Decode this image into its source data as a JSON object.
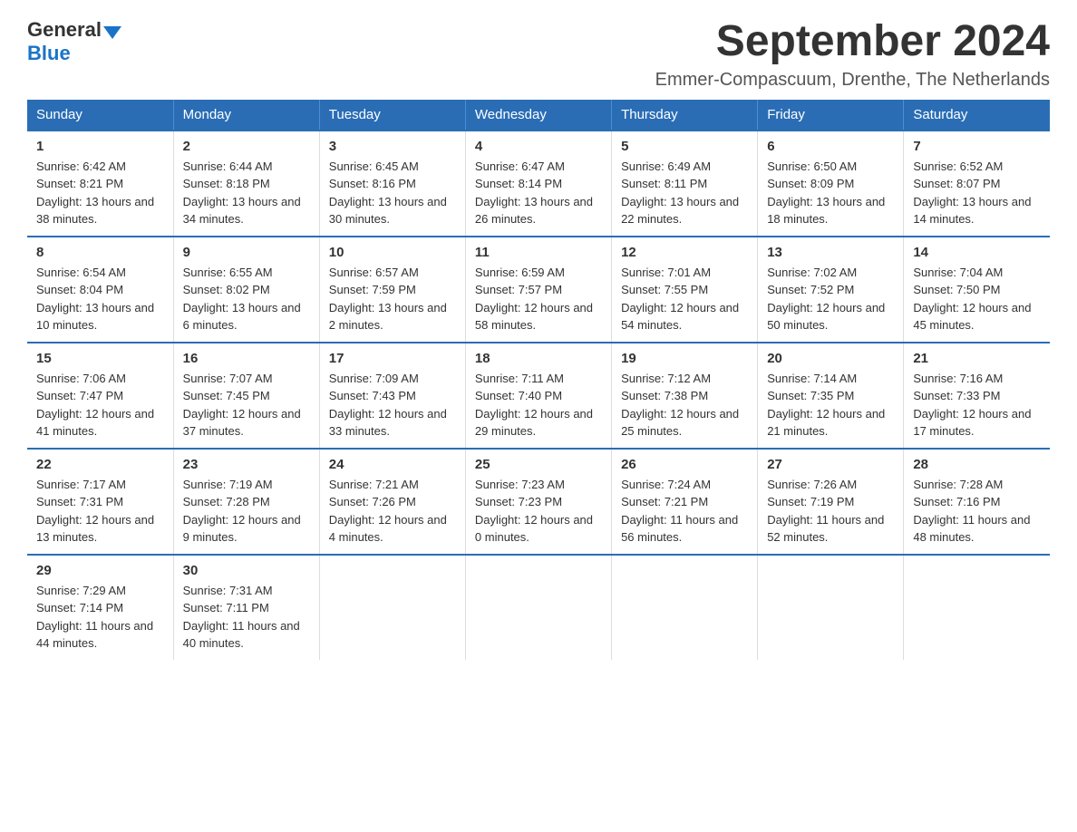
{
  "logo": {
    "general": "General",
    "blue": "Blue"
  },
  "title": {
    "month": "September 2024",
    "location": "Emmer-Compascuum, Drenthe, The Netherlands"
  },
  "header": {
    "days": [
      "Sunday",
      "Monday",
      "Tuesday",
      "Wednesday",
      "Thursday",
      "Friday",
      "Saturday"
    ]
  },
  "weeks": [
    [
      {
        "day": "1",
        "sunrise": "6:42 AM",
        "sunset": "8:21 PM",
        "daylight": "13 hours and 38 minutes."
      },
      {
        "day": "2",
        "sunrise": "6:44 AM",
        "sunset": "8:18 PM",
        "daylight": "13 hours and 34 minutes."
      },
      {
        "day": "3",
        "sunrise": "6:45 AM",
        "sunset": "8:16 PM",
        "daylight": "13 hours and 30 minutes."
      },
      {
        "day": "4",
        "sunrise": "6:47 AM",
        "sunset": "8:14 PM",
        "daylight": "13 hours and 26 minutes."
      },
      {
        "day": "5",
        "sunrise": "6:49 AM",
        "sunset": "8:11 PM",
        "daylight": "13 hours and 22 minutes."
      },
      {
        "day": "6",
        "sunrise": "6:50 AM",
        "sunset": "8:09 PM",
        "daylight": "13 hours and 18 minutes."
      },
      {
        "day": "7",
        "sunrise": "6:52 AM",
        "sunset": "8:07 PM",
        "daylight": "13 hours and 14 minutes."
      }
    ],
    [
      {
        "day": "8",
        "sunrise": "6:54 AM",
        "sunset": "8:04 PM",
        "daylight": "13 hours and 10 minutes."
      },
      {
        "day": "9",
        "sunrise": "6:55 AM",
        "sunset": "8:02 PM",
        "daylight": "13 hours and 6 minutes."
      },
      {
        "day": "10",
        "sunrise": "6:57 AM",
        "sunset": "7:59 PM",
        "daylight": "13 hours and 2 minutes."
      },
      {
        "day": "11",
        "sunrise": "6:59 AM",
        "sunset": "7:57 PM",
        "daylight": "12 hours and 58 minutes."
      },
      {
        "day": "12",
        "sunrise": "7:01 AM",
        "sunset": "7:55 PM",
        "daylight": "12 hours and 54 minutes."
      },
      {
        "day": "13",
        "sunrise": "7:02 AM",
        "sunset": "7:52 PM",
        "daylight": "12 hours and 50 minutes."
      },
      {
        "day": "14",
        "sunrise": "7:04 AM",
        "sunset": "7:50 PM",
        "daylight": "12 hours and 45 minutes."
      }
    ],
    [
      {
        "day": "15",
        "sunrise": "7:06 AM",
        "sunset": "7:47 PM",
        "daylight": "12 hours and 41 minutes."
      },
      {
        "day": "16",
        "sunrise": "7:07 AM",
        "sunset": "7:45 PM",
        "daylight": "12 hours and 37 minutes."
      },
      {
        "day": "17",
        "sunrise": "7:09 AM",
        "sunset": "7:43 PM",
        "daylight": "12 hours and 33 minutes."
      },
      {
        "day": "18",
        "sunrise": "7:11 AM",
        "sunset": "7:40 PM",
        "daylight": "12 hours and 29 minutes."
      },
      {
        "day": "19",
        "sunrise": "7:12 AM",
        "sunset": "7:38 PM",
        "daylight": "12 hours and 25 minutes."
      },
      {
        "day": "20",
        "sunrise": "7:14 AM",
        "sunset": "7:35 PM",
        "daylight": "12 hours and 21 minutes."
      },
      {
        "day": "21",
        "sunrise": "7:16 AM",
        "sunset": "7:33 PM",
        "daylight": "12 hours and 17 minutes."
      }
    ],
    [
      {
        "day": "22",
        "sunrise": "7:17 AM",
        "sunset": "7:31 PM",
        "daylight": "12 hours and 13 minutes."
      },
      {
        "day": "23",
        "sunrise": "7:19 AM",
        "sunset": "7:28 PM",
        "daylight": "12 hours and 9 minutes."
      },
      {
        "day": "24",
        "sunrise": "7:21 AM",
        "sunset": "7:26 PM",
        "daylight": "12 hours and 4 minutes."
      },
      {
        "day": "25",
        "sunrise": "7:23 AM",
        "sunset": "7:23 PM",
        "daylight": "12 hours and 0 minutes."
      },
      {
        "day": "26",
        "sunrise": "7:24 AM",
        "sunset": "7:21 PM",
        "daylight": "11 hours and 56 minutes."
      },
      {
        "day": "27",
        "sunrise": "7:26 AM",
        "sunset": "7:19 PM",
        "daylight": "11 hours and 52 minutes."
      },
      {
        "day": "28",
        "sunrise": "7:28 AM",
        "sunset": "7:16 PM",
        "daylight": "11 hours and 48 minutes."
      }
    ],
    [
      {
        "day": "29",
        "sunrise": "7:29 AM",
        "sunset": "7:14 PM",
        "daylight": "11 hours and 44 minutes."
      },
      {
        "day": "30",
        "sunrise": "7:31 AM",
        "sunset": "7:11 PM",
        "daylight": "11 hours and 40 minutes."
      },
      null,
      null,
      null,
      null,
      null
    ]
  ]
}
